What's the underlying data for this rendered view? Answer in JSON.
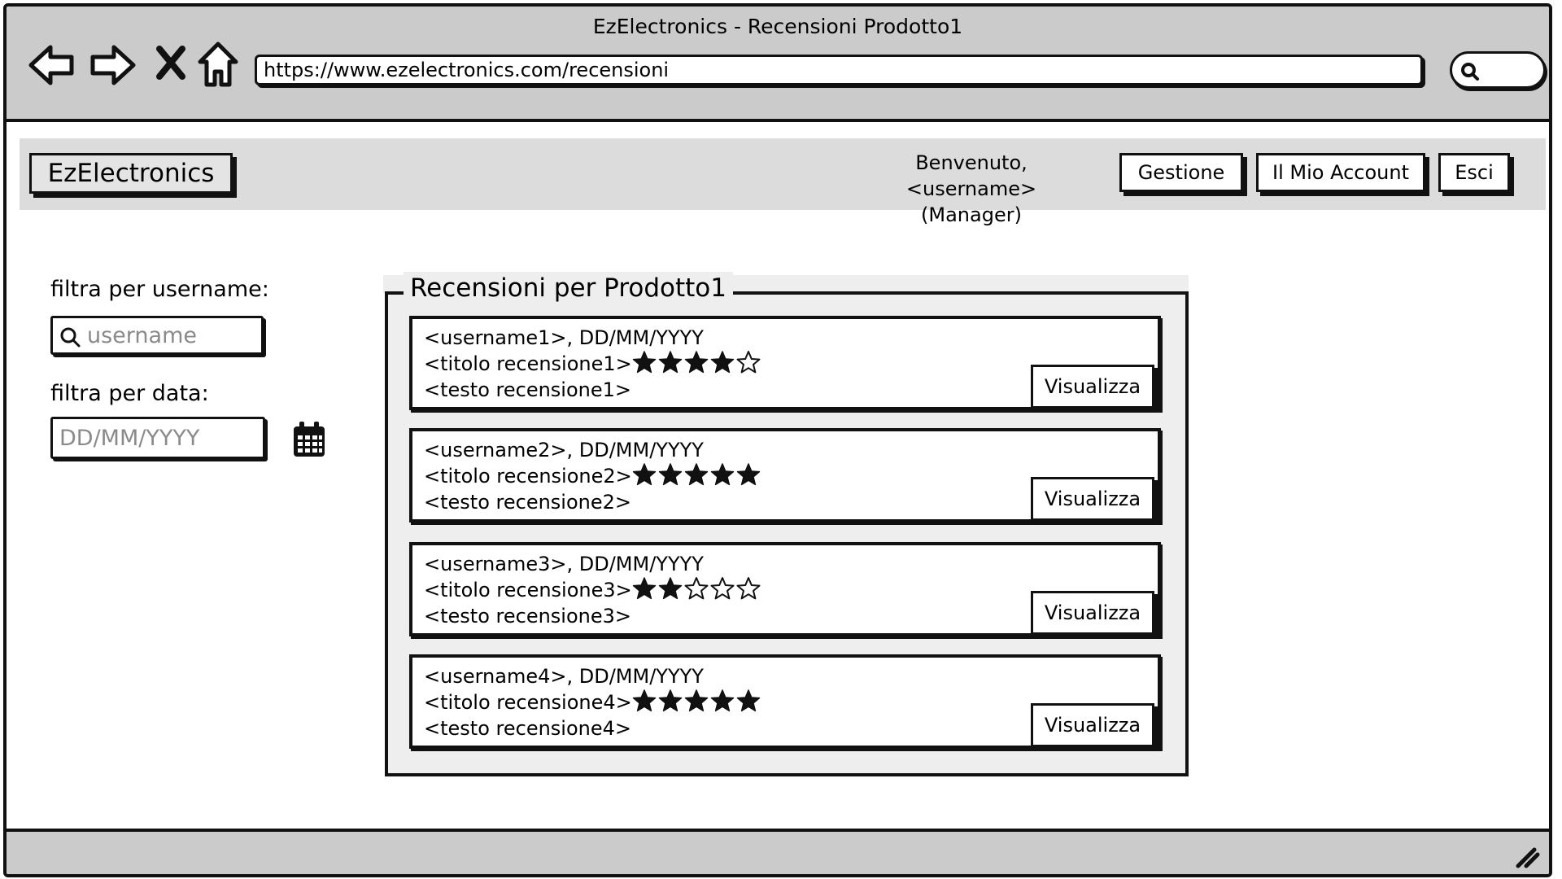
{
  "window": {
    "title": "EzElectronics - Recensioni Prodotto1",
    "url": "https://www.ezelectronics.com/recensioni"
  },
  "header": {
    "logo": "EzElectronics",
    "welcome_line1": "Benvenuto, <username>",
    "welcome_line2": "(Manager)",
    "buttons": {
      "gestione": "Gestione",
      "account": "Il Mio Account",
      "esci": "Esci"
    }
  },
  "filters": {
    "username_label": "filtra per username:",
    "username_placeholder": "username",
    "date_label": "filtra per data:",
    "date_placeholder": "DD/MM/YYYY"
  },
  "panel": {
    "title": "Recensioni per Prodotto1"
  },
  "reviews": [
    {
      "line1": "<username1>, DD/MM/YYYY",
      "line2": "<titolo recensione1>",
      "line3": "<testo recensione1>",
      "rating": 4,
      "button": "Visualizza"
    },
    {
      "line1": "<username2>, DD/MM/YYYY",
      "line2": "<titolo recensione2>",
      "line3": "<testo recensione2>",
      "rating": 5,
      "button": "Visualizza"
    },
    {
      "line1": "<username3>, DD/MM/YYYY",
      "line2": "<titolo recensione3>",
      "line3": "<testo recensione3>",
      "rating": 2,
      "button": "Visualizza"
    },
    {
      "line1": "<username4>, DD/MM/YYYY",
      "line2": "<titolo recensione4>",
      "line3": "<testo recensione4>",
      "rating": 5,
      "button": "Visualizza"
    }
  ],
  "icons": {
    "back": "back-arrow-icon",
    "forward": "forward-arrow-icon",
    "stop": "close-icon",
    "home": "home-icon",
    "search": "search-icon",
    "calendar": "calendar-icon",
    "star_filled": "star-filled-icon",
    "star_empty": "star-outline-icon",
    "resize": "resize-grip-icon"
  }
}
